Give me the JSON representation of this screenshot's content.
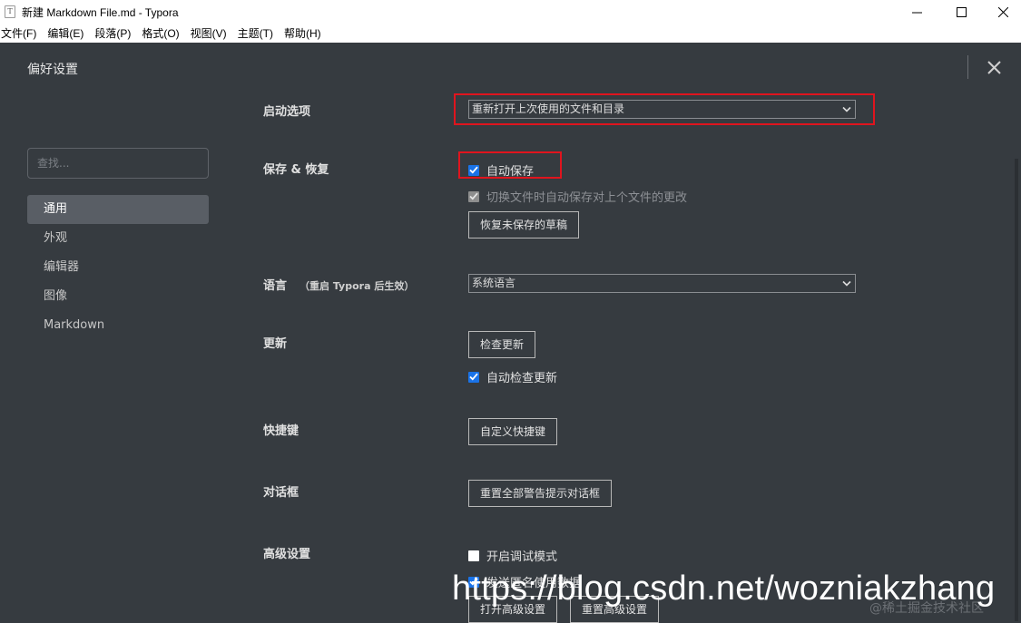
{
  "window": {
    "title": "新建 Markdown File.md - Typora",
    "app_icon_letter": "T"
  },
  "menu": [
    "文件(F)",
    "编辑(E)",
    "段落(P)",
    "格式(O)",
    "视图(V)",
    "主题(T)",
    "帮助(H)"
  ],
  "prefs": {
    "title": "偏好设置"
  },
  "sidebar": {
    "search_placeholder": "查找...",
    "items": [
      "通用",
      "外观",
      "编辑器",
      "图像",
      "Markdown"
    ],
    "active_index": 0
  },
  "sections": {
    "startup": {
      "label": "启动选项",
      "select_value": "重新打开上次使用的文件和目录"
    },
    "save": {
      "label": "保存 & 恢复",
      "autosave_label": "自动保存",
      "autosave_checked": true,
      "switch_save_label": "切换文件时自动保存对上个文件的更改",
      "switch_save_checked": true,
      "switch_save_disabled": true,
      "recover_button": "恢复未保存的草稿"
    },
    "language": {
      "label": "语言",
      "note": "（重启 Typora 后生效）",
      "select_value": "系统语言"
    },
    "update": {
      "label": "更新",
      "check_button": "检查更新",
      "auto_check_label": "自动检查更新",
      "auto_check_checked": true
    },
    "shortcuts": {
      "label": "快捷键",
      "button": "自定义快捷键"
    },
    "dialogs": {
      "label": "对话框",
      "button": "重置全部警告提示对话框"
    },
    "advanced": {
      "label": "高级设置",
      "debug_label": "开启调试模式",
      "debug_checked": false,
      "telemetry_label": "发送匿名使用数据",
      "telemetry_checked": true,
      "open_button": "打开高级设置",
      "reset_button": "重置高级设置"
    }
  },
  "overlay": {
    "url_watermark": "https://blog.csdn.net/wozniakzhang",
    "community_watermark": "@稀土掘金技术社区"
  },
  "colors": {
    "background": "#363b40",
    "highlight": "#e0141e",
    "checkbox": "#1a73e8"
  }
}
